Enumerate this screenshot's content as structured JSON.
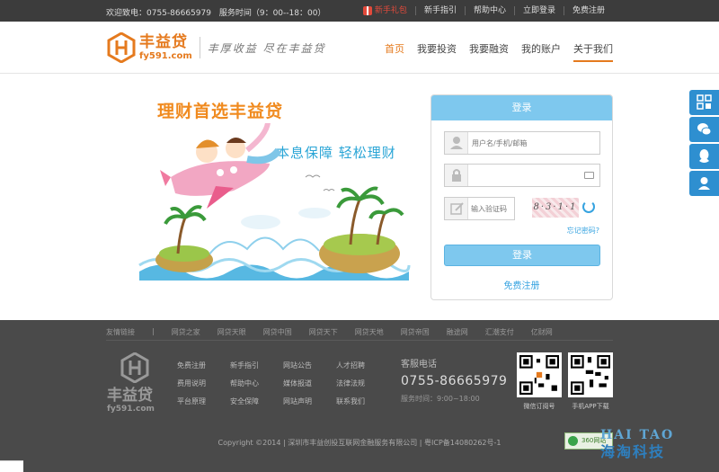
{
  "topbar": {
    "hotline": "欢迎致电：0755-86665979",
    "service_time": "服务时间（9：00--18：00）",
    "links": [
      "新手礼包",
      "新手指引",
      "帮助中心",
      "立即登录",
      "免费注册"
    ]
  },
  "header": {
    "logo_cn": "丰益贷",
    "logo_en": "fy591.com",
    "slogan": "丰厚收益  尽在丰益贷",
    "nav": [
      "首页",
      "我要投资",
      "我要融资",
      "我的账户",
      "关于我们"
    ]
  },
  "hero": {
    "title": "理财首选丰益贷",
    "subtitle": "本息保障  轻松理财"
  },
  "login": {
    "heading": "登录",
    "username_placeholder": "用户名/手机/邮箱",
    "password_placeholder": "",
    "captcha_placeholder": "输入验证码",
    "captcha_text": "8·3·1·1",
    "forgot": "忘记密码?",
    "submit": "登录",
    "register": "免费注册"
  },
  "footer": {
    "links_label": "友情链接",
    "links_sep": "|",
    "links": [
      "网贷之家",
      "网贷天眼",
      "网贷中国",
      "网贷天下",
      "网贷天地",
      "网贷帝国",
      "融途网",
      "汇潮支付",
      "亿财网"
    ],
    "logo_cn": "丰益贷",
    "logo_en": "fy591.com",
    "columns": [
      [
        "免费注册",
        "费用说明",
        "平台原理"
      ],
      [
        "新手指引",
        "帮助中心",
        "安全保障"
      ],
      [
        "网站公告",
        "媒体报道",
        "网站声明"
      ],
      [
        "人才招聘",
        "法律法规",
        "联系我们"
      ]
    ],
    "hotline_label": "客服电话",
    "hotline_number": "0755-86665979",
    "hotline_time": "服务时间：9:00~18:00",
    "qr_wechat": "微信订阅号",
    "qr_app": "手机APP下载",
    "copyright": "Copyright ©2014 | 深圳市丰益创投互联网金融服务有限公司 | 粤ICP备14080262号-1",
    "badge": "360网站"
  },
  "watermark": {
    "top": "HAI TAO",
    "bottom": "海淘科技"
  },
  "colors": {
    "brand_orange": "#e57a1e",
    "login_blue": "#7ec8ee",
    "side_blue": "#2e8fd0",
    "footer_bg": "#4a4a4a"
  },
  "side_icons": [
    "qr-code-icon",
    "wechat-icon",
    "qq-icon",
    "customer-service-icon"
  ]
}
